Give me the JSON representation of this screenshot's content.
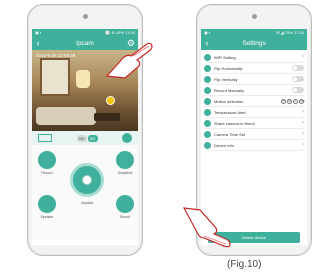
{
  "left_phone": {
    "status_left": "▣ ▪",
    "status_right": "⚪ ⊕ 19% 17:04",
    "title": "Ipcam",
    "timestamp": "2016-5-26 12:09:38",
    "tabs": [
      "HD",
      "SD"
    ],
    "controls": {
      "record_label": "Record",
      "snapshot_label": "Snapshot",
      "speaker_label": "Speaker",
      "sound_label": "Sound",
      "joystick_label": "Joystick"
    }
  },
  "right_phone": {
    "status_right": "✉ ◢ 75% 17:24",
    "title": "Settings",
    "items": [
      {
        "label": "WiFi Setting",
        "kind": "chevron"
      },
      {
        "label": "Flip Horizontally",
        "kind": "toggle"
      },
      {
        "label": "Flip Vertically",
        "kind": "toggle"
      },
      {
        "label": "Record Manually",
        "kind": "toggle"
      },
      {
        "label": "Motion detection",
        "kind": "levels",
        "levels": [
          "H",
          "M",
          "L",
          "OFF"
        ]
      },
      {
        "label": "Temperature Alert",
        "kind": "chevron"
      },
      {
        "label": "Share camera to friend",
        "kind": "chevron"
      },
      {
        "label": "Camera Time Set",
        "kind": "chevron"
      },
      {
        "label": "Device info",
        "kind": "chevron"
      }
    ],
    "delete_label": "Delete device"
  },
  "caption": "(Fig.10)",
  "colors": {
    "accent": "#3fb09b"
  }
}
